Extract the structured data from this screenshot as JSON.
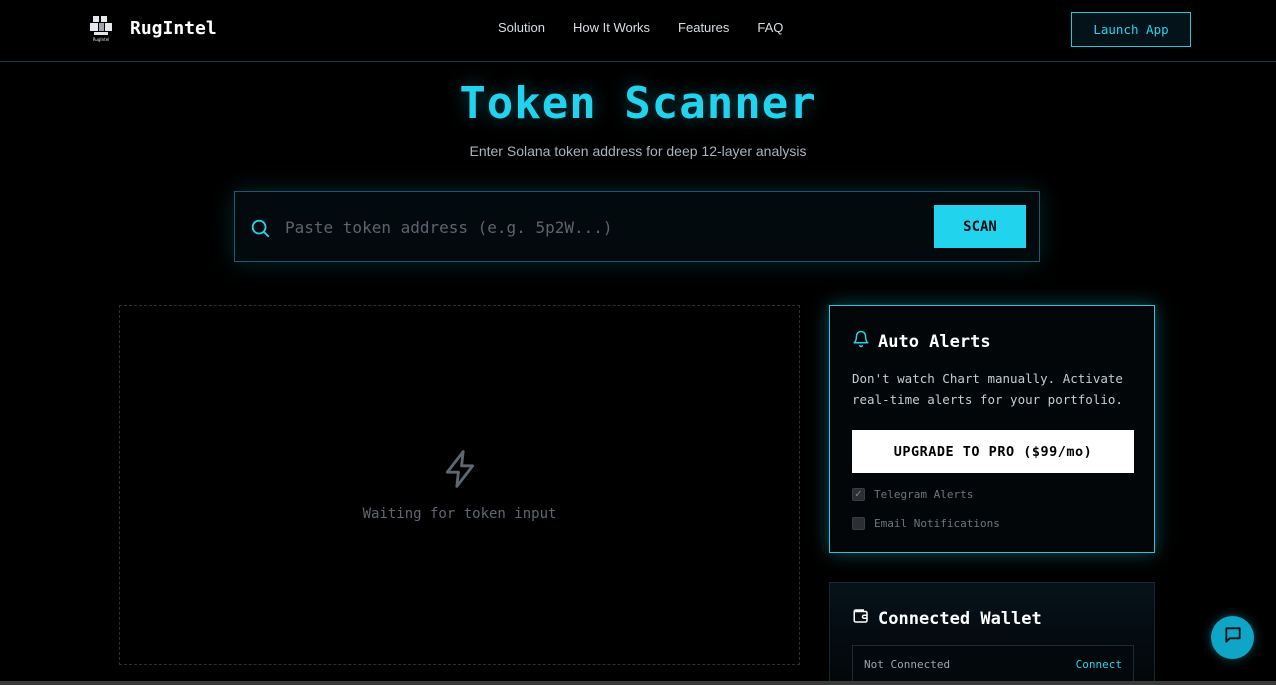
{
  "brand": {
    "name": "RugIntel",
    "logo_caption": "RugIntel"
  },
  "nav": {
    "links": [
      "Solution",
      "How It Works",
      "Features",
      "FAQ"
    ],
    "cta_label": "Launch App"
  },
  "hero": {
    "title": "Token Scanner",
    "subtitle": "Enter Solana token address for deep 12-layer analysis"
  },
  "search": {
    "placeholder": "Paste token address (e.g. 5p2W...)",
    "value": "",
    "button_label": "SCAN"
  },
  "result": {
    "empty_text": "Waiting for token input"
  },
  "alerts": {
    "title": "Auto Alerts",
    "description": "Don't watch Chart manually. Activate real-time alerts for your portfolio.",
    "upgrade_label": "UPGRADE TO PRO ($99/mo)",
    "options": [
      {
        "label": "Telegram Alerts",
        "checked": true
      },
      {
        "label": "Email Notifications",
        "checked": false
      }
    ]
  },
  "wallet": {
    "title": "Connected Wallet",
    "status": "Not Connected",
    "connect_label": "Connect"
  },
  "colors": {
    "accent": "#22d3ee",
    "background": "#000000",
    "card_border": "#22c8e0"
  },
  "icons": {
    "search": "search-icon",
    "bolt": "bolt-icon",
    "bell": "bell-icon",
    "wallet": "wallet-icon",
    "chat": "chat-icon"
  }
}
